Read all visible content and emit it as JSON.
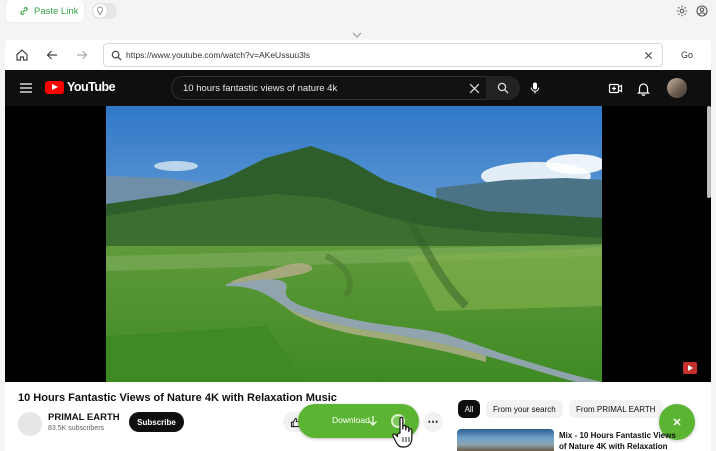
{
  "app": {
    "paste_link_label": "Paste Link",
    "toggle_state": "off"
  },
  "browser": {
    "url": "https://www.youtube.com/watch?v=AKeUssuu3ls",
    "go_label": "Go"
  },
  "youtube": {
    "logo_text": "YouTube",
    "search_query": "10 hours fantastic views of nature 4k",
    "video_title": "10 Hours Fantastic Views of Nature 4K with Relaxation Music",
    "channel": {
      "name": "PRIMAL EARTH",
      "subscribers": "83.5K subscribers"
    },
    "subscribe_label": "Subscribe",
    "filter_chips": [
      "All",
      "From your search",
      "From PRIMAL EARTH"
    ],
    "recommendation": {
      "title_line1": "Mix - 10 Hours Fantastic Views",
      "title_line2": "of Nature 4K with Relaxation"
    }
  },
  "overlay": {
    "download_label": "Download",
    "accent_color": "#5cb532"
  }
}
